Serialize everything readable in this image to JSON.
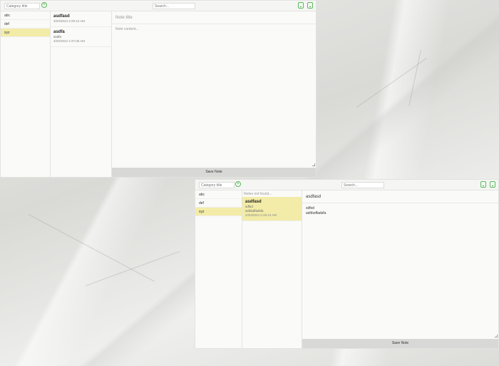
{
  "window_a": {
    "category_placeholder": "Category title",
    "search_placeholder": "Search...",
    "categories": [
      {
        "label": "abc",
        "selected": false
      },
      {
        "label": "def",
        "selected": false
      },
      {
        "label": "xyz",
        "selected": true
      }
    ],
    "notes": [
      {
        "title": "asdfasd",
        "body": "",
        "date": "3/20/2024 2:29:12 AM"
      },
      {
        "title": "asdfa",
        "body": "asdfa",
        "date": "3/20/2024 2:37:06 AM"
      }
    ],
    "editor": {
      "title_placeholder": "Note title",
      "content_placeholder": "Note content..."
    },
    "save_label": "Save Note"
  },
  "window_b": {
    "category_placeholder": "Category title",
    "search_placeholder": "Search...",
    "categories": [
      {
        "label": "abc",
        "selected": false
      },
      {
        "label": "def",
        "selected": false
      },
      {
        "label": "xyz",
        "selected": true
      }
    ],
    "empty_message": "Notes not found...",
    "notes": [
      {
        "title": "asdfasd",
        "lines": [
          "sdfsd",
          "asfdsdfadsfa"
        ],
        "date": "3/20/2024 2:28:12 AM"
      }
    ],
    "editor": {
      "title": "asdfasd",
      "content": "sdfsd\nasfdsdfadsfa"
    },
    "save_label": "Save Note"
  },
  "icons": {
    "add": "plus-circle-icon",
    "layers": "layers-icon",
    "new_note": "new-document-icon"
  },
  "colors": {
    "selected": "#f3eca8",
    "accent_green": "#5cb85c",
    "save_bar": "#d8d8d6"
  }
}
